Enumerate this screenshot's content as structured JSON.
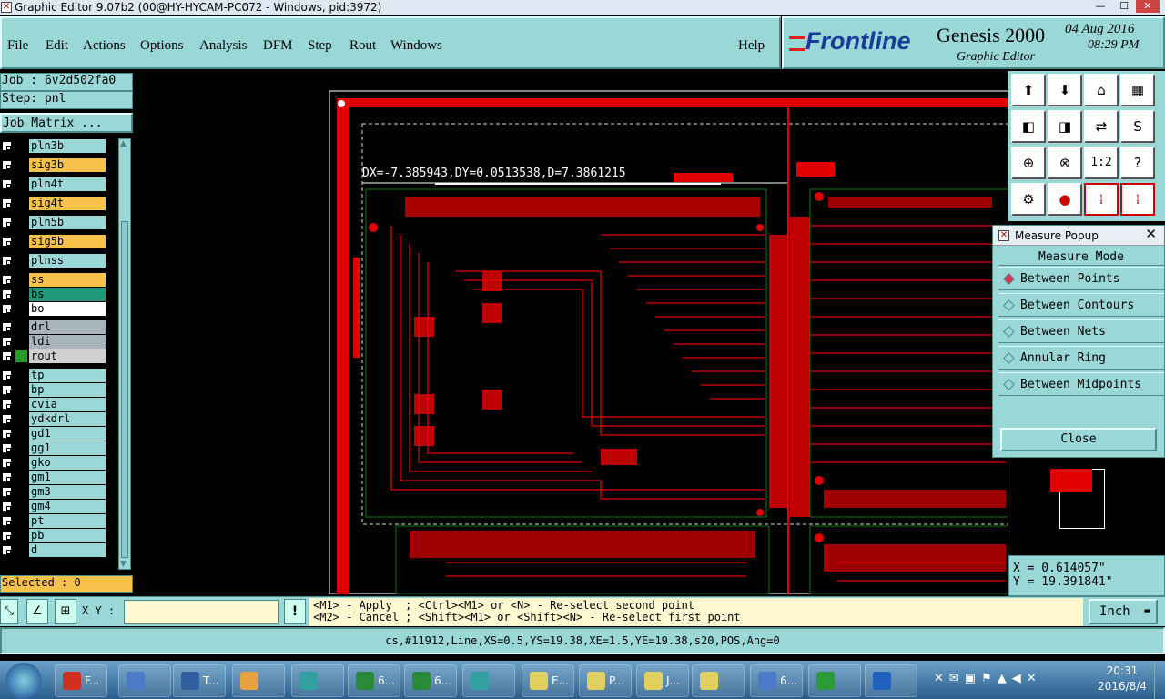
{
  "window": {
    "title": "Graphic Editor 9.07b2 (00@HY-HYCAM-PC072 - Windows, pid:3972)",
    "min": "—",
    "max": "☐",
    "close": "✕"
  },
  "menu": [
    {
      "label": "File"
    },
    {
      "label": "Edit"
    },
    {
      "label": "Actions"
    },
    {
      "label": "Options"
    },
    {
      "label": "Analysis"
    },
    {
      "label": "DFM"
    },
    {
      "label": "Step"
    },
    {
      "label": "Rout"
    },
    {
      "label": "Windows"
    },
    {
      "label": "Help"
    }
  ],
  "brand": {
    "logo": "Frontline",
    "product": "Genesis 2000",
    "sub": "Graphic Editor",
    "date": "04 Aug 2016",
    "time": "08:29 PM"
  },
  "job": {
    "job_line": "Job : 6v2d502fa0",
    "step_line": "Step: pnl",
    "matrix_button": "Job Matrix ...",
    "selected": "Selected : 0"
  },
  "layers": [
    {
      "name": "pln3b",
      "color": "#9ad8d8"
    },
    {
      "name": "sig3b",
      "color": "#f7c24a"
    },
    {
      "name": "pln4t",
      "color": "#9ad8d8"
    },
    {
      "name": "sig4t",
      "color": "#f7c24a"
    },
    {
      "name": "pln5b",
      "color": "#9ad8d8"
    },
    {
      "name": "sig5b",
      "color": "#f7c24a"
    },
    {
      "name": "plnss",
      "color": "#9ad8d8"
    },
    {
      "name": "ss",
      "color": "#f7c24a"
    },
    {
      "name": "bs",
      "color": "#1e9a7a"
    },
    {
      "name": "bo",
      "color": "#ffffff"
    },
    {
      "name": "drl",
      "color": "#a8b4bc"
    },
    {
      "name": "ldi",
      "color": "#a8b4bc"
    },
    {
      "name": "rout",
      "color": "#d0d0d0"
    },
    {
      "name": "tp",
      "color": "#9ad8d8"
    },
    {
      "name": "bp",
      "color": "#9ad8d8"
    },
    {
      "name": "cvia",
      "color": "#9ad8d8"
    },
    {
      "name": "ydkdrl",
      "color": "#9ad8d8"
    },
    {
      "name": "gd1",
      "color": "#9ad8d8"
    },
    {
      "name": "gg1",
      "color": "#9ad8d8"
    },
    {
      "name": "gko",
      "color": "#9ad8d8"
    },
    {
      "name": "gm1",
      "color": "#9ad8d8"
    },
    {
      "name": "gm3",
      "color": "#9ad8d8"
    },
    {
      "name": "gm4",
      "color": "#9ad8d8"
    },
    {
      "name": "pt",
      "color": "#9ad8d8"
    },
    {
      "name": "pb",
      "color": "#9ad8d8"
    },
    {
      "name": "d",
      "color": "#9ad8d8"
    }
  ],
  "canvas": {
    "measure_readout": "DX=-7.385943,DY=0.0513538,D=7.3861215"
  },
  "toolbox": {
    "buttons": [
      "1:2",
      "?"
    ]
  },
  "measure": {
    "title": "Measure Popup",
    "mode_label": "Measure Mode",
    "options": [
      "Between Points",
      "Between Contours",
      "Between Nets",
      "Annular Ring",
      "Between Midpoints"
    ],
    "selected": "Between Points",
    "close": "Close"
  },
  "coords": {
    "x": "X = 0.614057\"",
    "y": "Y = 19.391841\""
  },
  "command": {
    "xy_label": "X Y :",
    "xy_value": "",
    "warn": "!",
    "hint1": "<M1> - Apply  ; <Ctrl><M1> or <N> - Re-select second point",
    "hint2": "<M2> - Cancel ; <Shift><M1> or <Shift><N> - Re-select first point",
    "units": "Inch"
  },
  "status": {
    "text": "cs,#11912,Line,XS=0.5,YS=19.38,XE=1.5,YE=19.38,s20,POS,Ang=0"
  },
  "taskbar": {
    "items": [
      {
        "label": "F...",
        "color": "#d03020"
      },
      {
        "label": "",
        "color": "#4a7ac8"
      },
      {
        "label": "T...",
        "color": "#3060a0"
      },
      {
        "label": "",
        "color": "#e8a040"
      },
      {
        "label": "",
        "color": "#30a0a0"
      },
      {
        "label": "6...",
        "color": "#2a8a3a"
      },
      {
        "label": "6...",
        "color": "#2a8a3a"
      },
      {
        "label": "",
        "color": "#30a0a0"
      },
      {
        "label": "E...",
        "color": "#e0d060"
      },
      {
        "label": "P...",
        "color": "#e0d060"
      },
      {
        "label": "J...",
        "color": "#e0d060"
      },
      {
        "label": "",
        "color": "#e0d060"
      },
      {
        "label": "6...",
        "color": "#4a7ac8"
      },
      {
        "label": "",
        "color": "#2a9a3a"
      },
      {
        "label": "",
        "color": "#2060c0"
      }
    ],
    "clock_time": "20:31",
    "clock_date": "2016/8/4"
  }
}
